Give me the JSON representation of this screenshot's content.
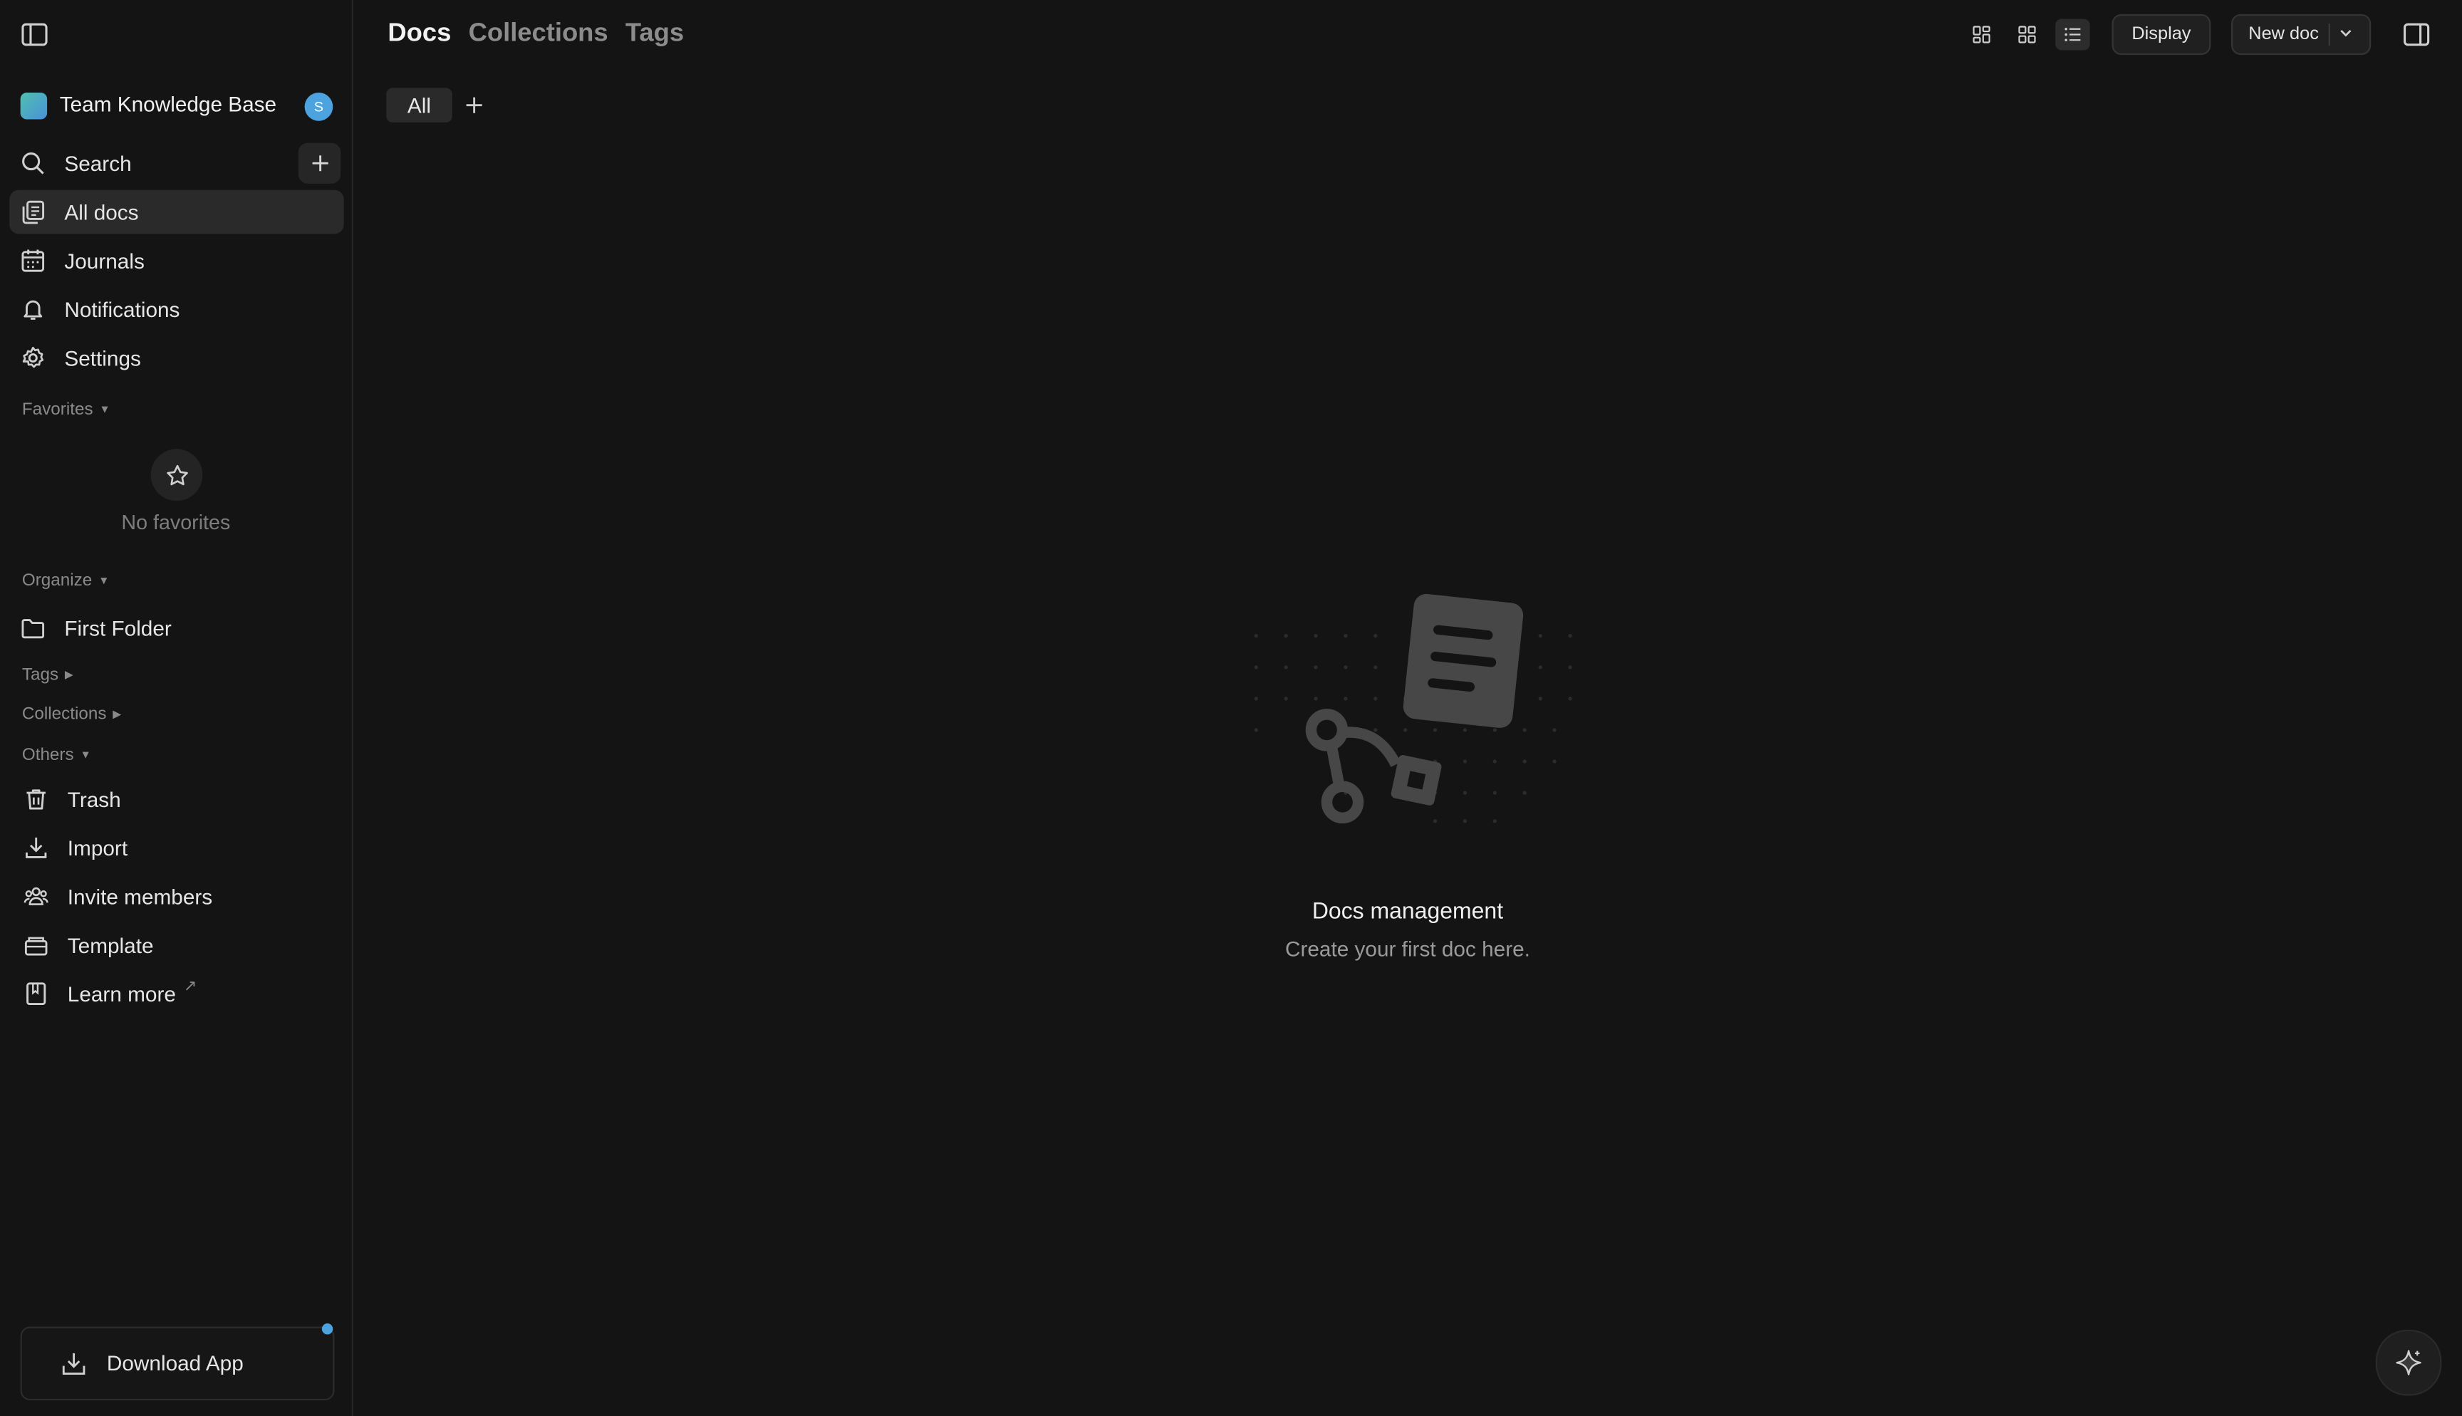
{
  "workspace": {
    "name": "Team Knowledge Base",
    "avatar_letter": "S",
    "accent": "#4da3e0"
  },
  "sidebar": {
    "search_label": "Search",
    "nav": [
      {
        "label": "All docs",
        "icon": "all-docs-icon",
        "active": true
      },
      {
        "label": "Journals",
        "icon": "calendar-icon"
      },
      {
        "label": "Notifications",
        "icon": "bell-icon"
      },
      {
        "label": "Settings",
        "icon": "gear-icon"
      }
    ],
    "favorites": {
      "header": "Favorites",
      "empty_text": "No favorites"
    },
    "organize": {
      "header": "Organize",
      "items": [
        {
          "label": "First Folder",
          "icon": "folder-icon"
        }
      ]
    },
    "tags_header": "Tags",
    "collections_header": "Collections",
    "others": {
      "header": "Others",
      "items": [
        {
          "label": "Trash",
          "icon": "trash-icon"
        },
        {
          "label": "Import",
          "icon": "import-icon"
        },
        {
          "label": "Invite members",
          "icon": "members-icon"
        },
        {
          "label": "Template",
          "icon": "template-icon"
        },
        {
          "label": "Learn more",
          "icon": "book-icon",
          "external": "↗"
        }
      ]
    },
    "download_app": "Download App"
  },
  "header": {
    "tabs": [
      {
        "label": "Docs",
        "active": true
      },
      {
        "label": "Collections",
        "active": false
      },
      {
        "label": "Tags",
        "active": false
      }
    ],
    "display_label": "Display",
    "new_doc_label": "New doc"
  },
  "filter": {
    "all_label": "All"
  },
  "empty_state": {
    "title": "Docs management",
    "subtitle": "Create your first doc here."
  }
}
